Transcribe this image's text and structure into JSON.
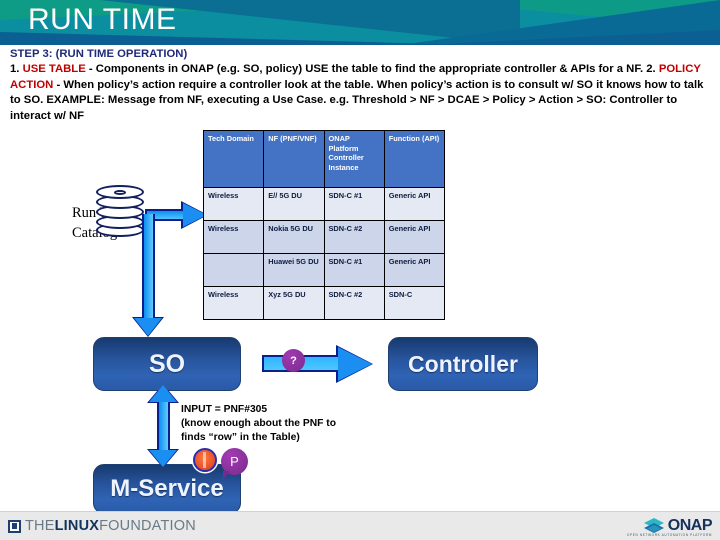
{
  "banner": {
    "title": "RUN TIME"
  },
  "body": {
    "step_heading": "STEP 3: (RUN TIME OPERATION)",
    "item1_num": "1.",
    "item1_key": "USE TABLE",
    "item1_text": " - Components in ONAP (e.g. SO, policy) USE the table to find the appropriate controller & APIs for a NF.",
    "item2_num": "2.",
    "item2_key": "POLICY ACTION",
    "item2_text": " - When policy’s action require a controller look at the table. When policy’s action is to consult w/ SO it knows how to talk to SO. EXAMPLE: Message from NF, executing a Use Case. e.g. Threshold > NF > DCAE > Policy > Action > SO: Controller to interact w/ NF"
  },
  "catalog": {
    "label": "Run Time Catalog",
    "icon": "database-cylinder-icon"
  },
  "table": {
    "headers": [
      "Tech Domain",
      "NF (PNF/VNF)",
      "ONAP Platform Controller Instance",
      "Function (API)"
    ],
    "rows": [
      [
        "Wireless",
        "E// 5G DU",
        "SDN-C #1",
        "Generic API"
      ],
      [
        "Wireless",
        "Nokia 5G DU",
        "SDN-C #2",
        "Generic API"
      ],
      [
        "",
        "Huawei 5G DU",
        "SDN-C #1",
        "Generic API"
      ],
      [
        "Wireless",
        "Xyz 5G DU",
        "SDN-C #2",
        "SDN-C"
      ]
    ]
  },
  "boxes": {
    "so": "SO",
    "controller": "Controller",
    "mservice": "M-Service"
  },
  "badges": {
    "question": "?",
    "policy": "P"
  },
  "note": {
    "line1": "INPUT = PNF#305",
    "line2": "(know enough about the PNF to",
    "line3": "finds “row” in the Table)"
  },
  "footer": {
    "lf_the": "THE",
    "lf_linux": "LINUX",
    "lf_foundation": "FOUNDATION",
    "onap_text": "ONAP",
    "onap_sub": "OPEN NETWORK AUTOMATION PLATFORM"
  },
  "colors": {
    "banner_teal": "#0e9c86",
    "banner_blue": "#0a6f92",
    "table_header": "#4472c4",
    "accent_red": "#c00000",
    "heading_navy": "#1f2a78",
    "arrow_blue": "#1b8ef2",
    "arrow_outline": "#0a1f8c",
    "badge_purple": "#7b2a8e"
  }
}
